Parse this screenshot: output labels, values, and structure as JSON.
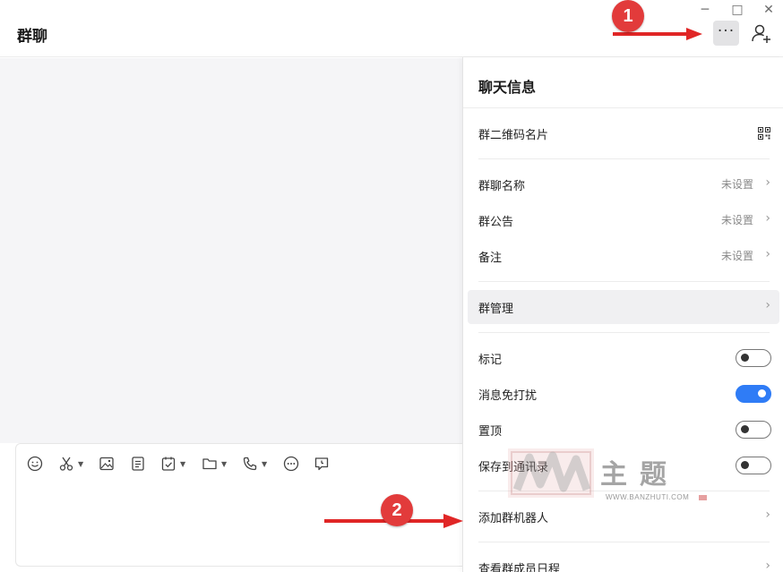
{
  "window": {
    "title": "群聊",
    "minimize_glyph": "─",
    "maximize_glyph": "□",
    "close_glyph": "✕",
    "more_glyph": "···"
  },
  "composer": {
    "tools": [
      "emoji-icon",
      "scissors-icon",
      "image-icon",
      "document-icon",
      "task-icon",
      "folder-icon",
      "phone-icon",
      "more-circle-icon",
      "chat-history-icon"
    ]
  },
  "panel": {
    "title": "聊天信息",
    "qr_card": "群二维码名片",
    "group_name": {
      "label": "群聊名称",
      "value": "未设置"
    },
    "announcement": {
      "label": "群公告",
      "value": "未设置"
    },
    "remark": {
      "label": "备注",
      "value": "未设置"
    },
    "manage": {
      "label": "群管理"
    },
    "mark": {
      "label": "标记",
      "on": false
    },
    "mute": {
      "label": "消息免打扰",
      "on": true
    },
    "pin": {
      "label": "置顶",
      "on": false
    },
    "save_contacts": {
      "label": "保存到通讯录",
      "on": false
    },
    "add_bot": {
      "label": "添加群机器人"
    },
    "member_schedule": {
      "label": "查看群成员日程"
    }
  },
  "annotations": {
    "step1": "1",
    "step2": "2",
    "color": "#e23b3b"
  },
  "watermark": {
    "text": "主题",
    "url": "WWW.BANZHUTI.COM"
  }
}
